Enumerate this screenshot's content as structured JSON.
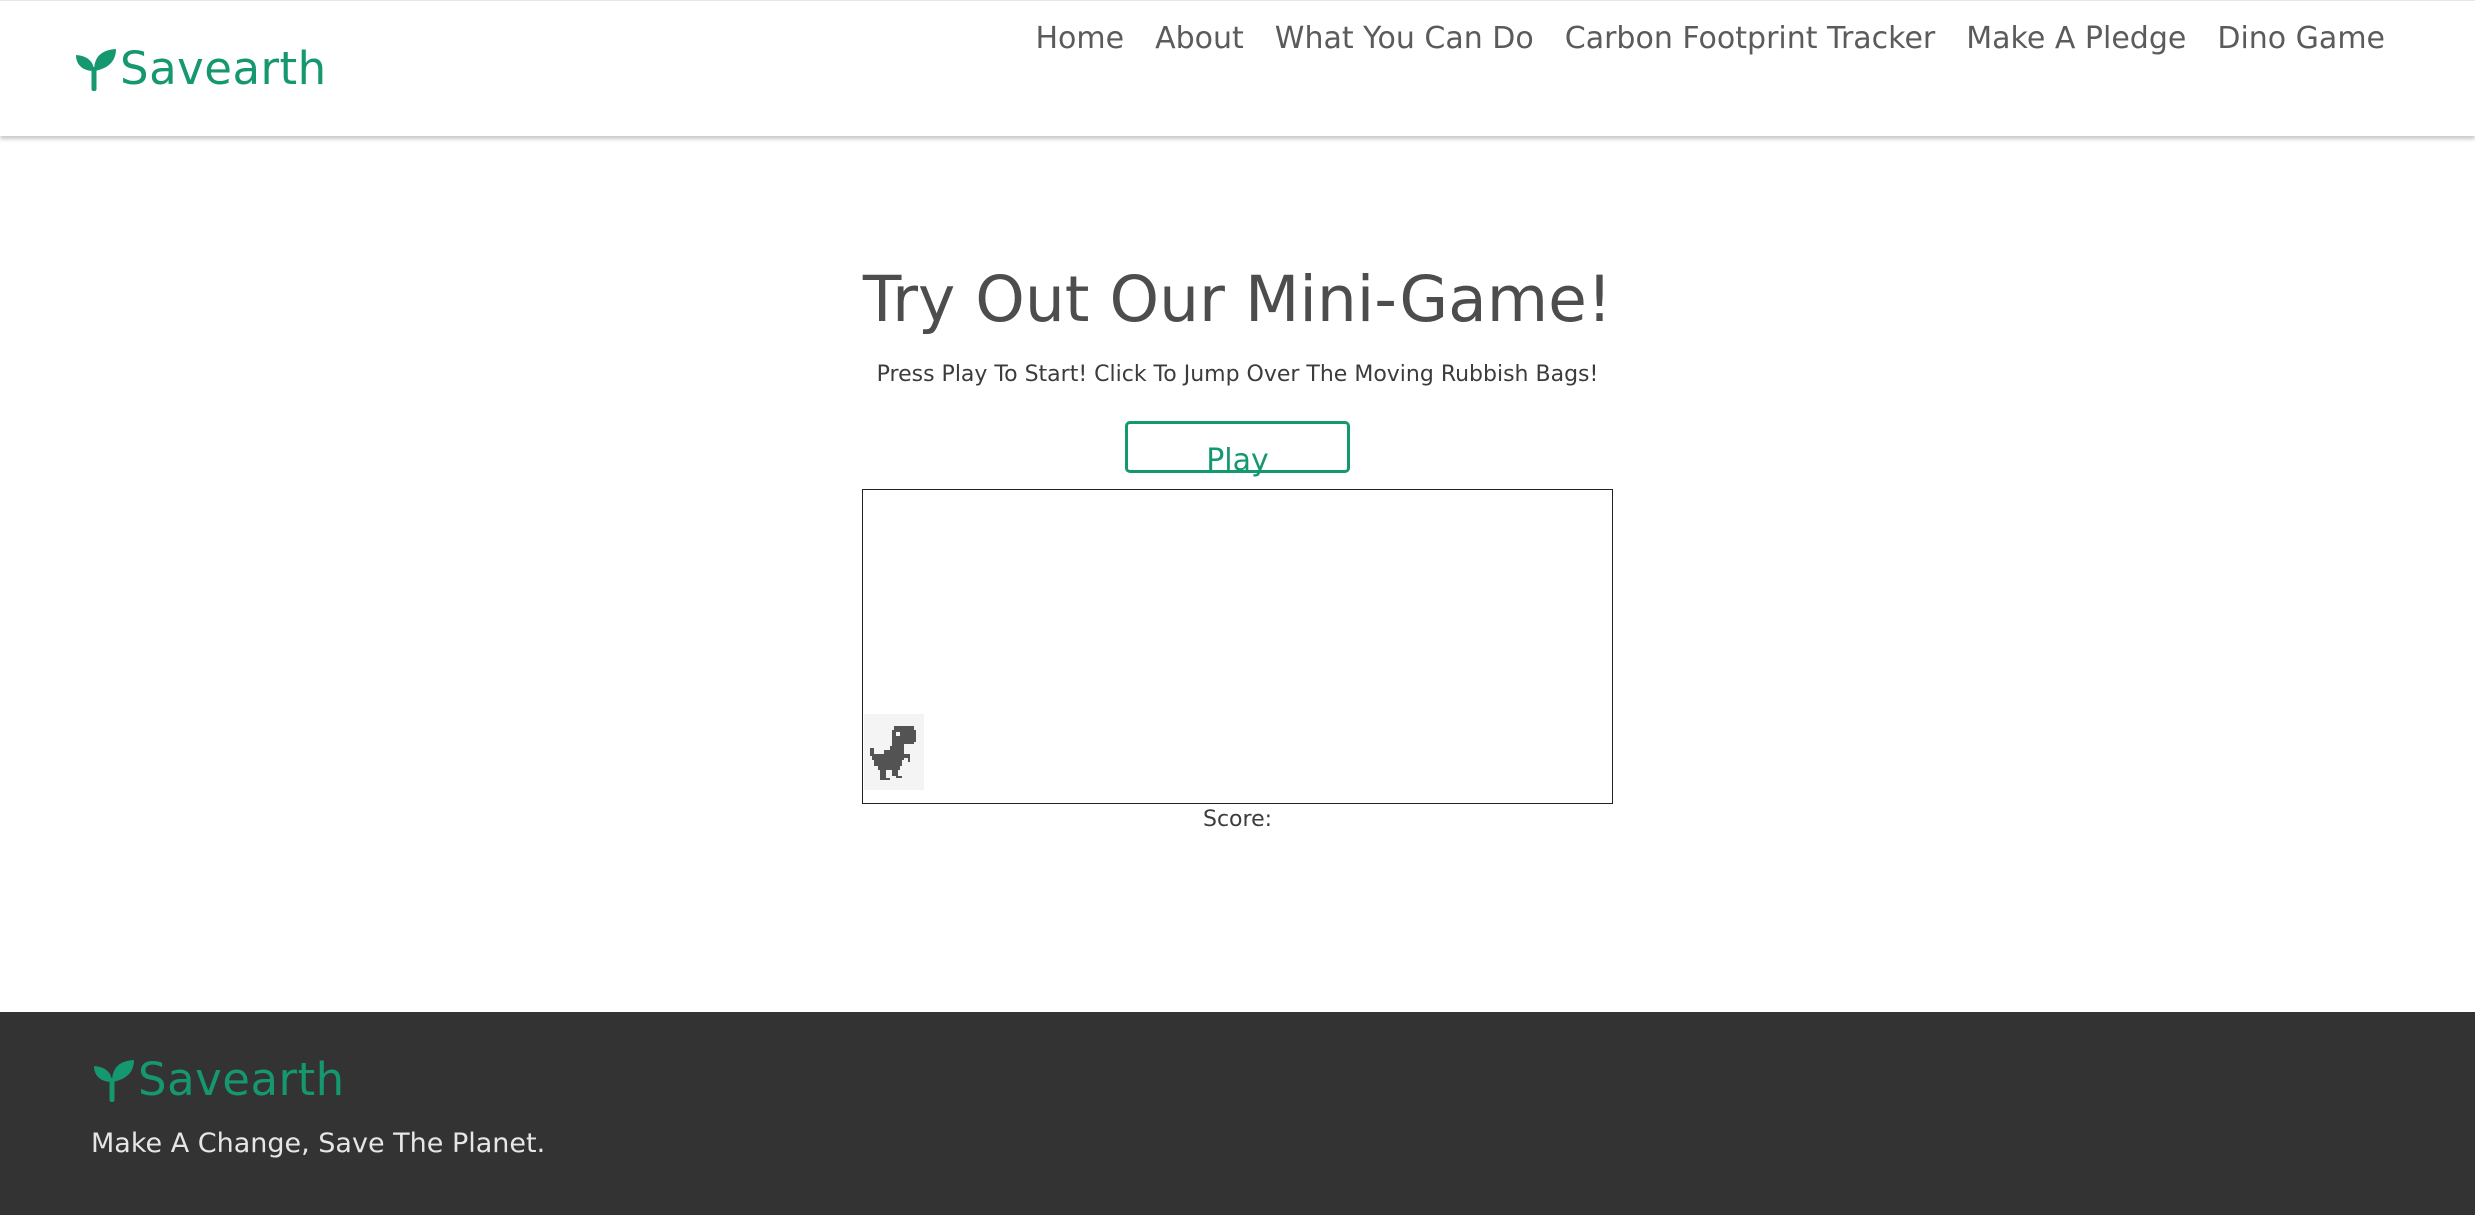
{
  "header": {
    "brand_name": "Savearth",
    "brand_icon": "seedling-icon",
    "nav": [
      {
        "label": "Home"
      },
      {
        "label": "About"
      },
      {
        "label": "What You Can Do"
      },
      {
        "label": "Carbon Footprint Tracker"
      },
      {
        "label": "Make A Pledge"
      },
      {
        "label": "Dino Game"
      }
    ]
  },
  "main": {
    "title": "Try Out Our Mini-Game!",
    "instructions": "Press Play To Start! Click To Jump Over The Moving Rubbish Bags!",
    "play_label": "Play",
    "score_label": "Score:",
    "player_icon": "dino-icon"
  },
  "footer": {
    "brand_name": "Savearth",
    "brand_icon": "seedling-icon",
    "tagline": "Make A Change, Save The Planet."
  },
  "colors": {
    "brand": "#15976f",
    "text": "#4d4d4d",
    "footer_bg": "#333333",
    "footer_text": "#e6e6e6"
  }
}
